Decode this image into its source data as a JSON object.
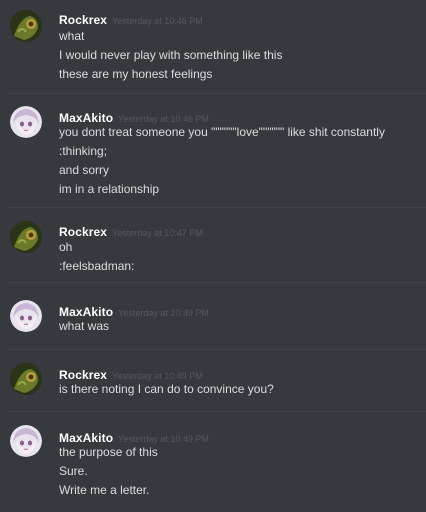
{
  "messages": [
    {
      "author": "Rockrex",
      "avatar": "rockrex-avatar",
      "timestamp": "Yesterday at 10:46 PM",
      "lines": [
        "what",
        "I would never play with something like this",
        "these are my honest feelings"
      ]
    },
    {
      "author": "MaxAkito",
      "avatar": "maxakito-avatar",
      "timestamp": "Yesterday at 10:46 PM",
      "lines": [
        "you dont treat someone you \"\"\"\"\"\"love\"\"\"\"\"\" like shit constantly",
        ":thinking;",
        "and sorry",
        "im in a relationship"
      ]
    },
    {
      "author": "Rockrex",
      "avatar": "rockrex-avatar",
      "timestamp": "Yesterday at 10:47 PM",
      "lines": [
        "oh",
        ":feelsbadman:"
      ]
    },
    {
      "author": "MaxAkito",
      "avatar": "maxakito-avatar",
      "timestamp": "Yesterday at 10:49 PM",
      "lines": [
        "what was"
      ]
    },
    {
      "author": "Rockrex",
      "avatar": "rockrex-avatar",
      "timestamp": "Yesterday at 10:49 PM",
      "lines": [
        "is there noting I can do to convince you?"
      ]
    },
    {
      "author": "MaxAkito",
      "avatar": "maxakito-avatar",
      "timestamp": "Yesterday at 10:49 PM",
      "lines": [
        "the purpose of this",
        "Sure.",
        "Write me a letter."
      ]
    }
  ],
  "colors": {
    "background": "#36393e",
    "divider": "#41444a",
    "username": "#ffffff",
    "timestamp": "#55585e",
    "text": "#dcddde"
  }
}
